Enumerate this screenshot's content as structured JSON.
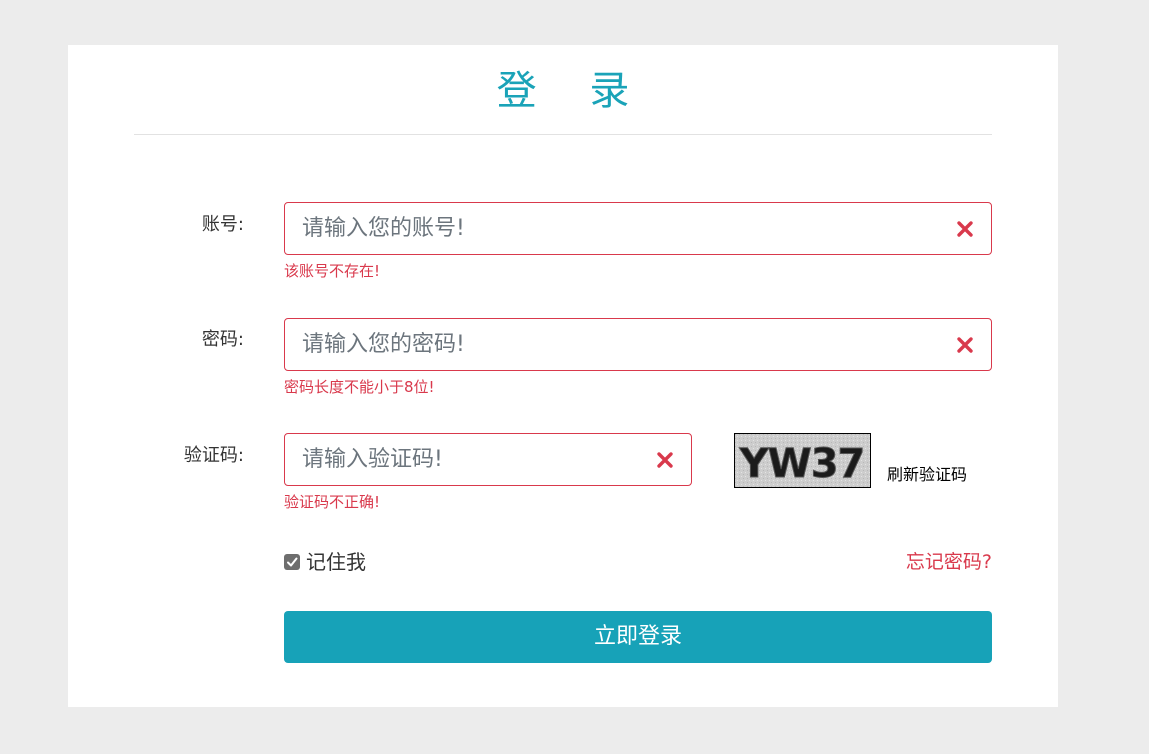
{
  "page": {
    "title": "登 录"
  },
  "form": {
    "account": {
      "label": "账号:",
      "placeholder": "请输入您的账号!",
      "error": "该账号不存在!"
    },
    "password": {
      "label": "密码:",
      "placeholder": "请输入您的密码!",
      "error": "密码长度不能小于8位!"
    },
    "captcha": {
      "label": "验证码:",
      "placeholder": "请输入验证码!",
      "error": "验证码不正确!",
      "image_text": "YW37",
      "refresh_label": "刷新验证码"
    },
    "remember": {
      "label": "记住我",
      "checked": true
    },
    "forgot_label": "忘记密码?",
    "submit_label": "立即登录"
  },
  "colors": {
    "accent": "#17a2b8",
    "error": "#d9394c",
    "background": "#ececec"
  },
  "icons": {
    "clear": "close-x-icon",
    "checkbox": "checkmark-icon"
  }
}
